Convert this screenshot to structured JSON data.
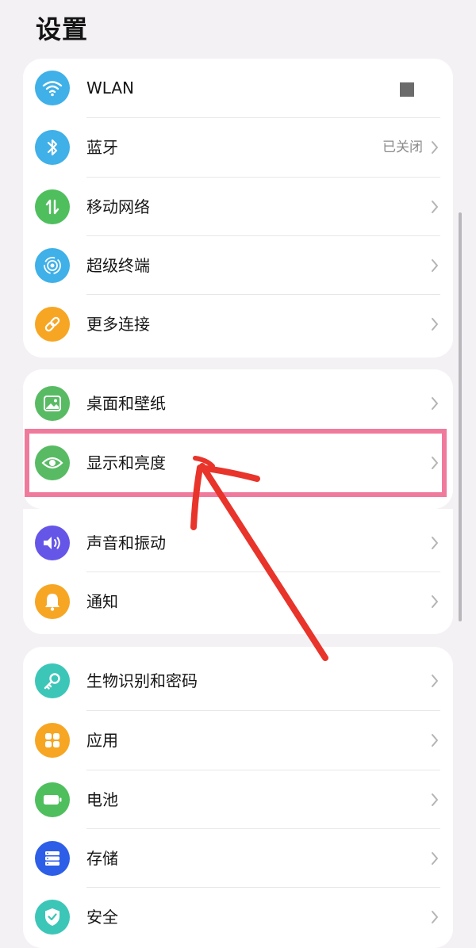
{
  "header": {
    "title": "设置"
  },
  "colors": {
    "wifi": "#3fb0e8",
    "bluetooth": "#3fb0e8",
    "mobile": "#4fbf5e",
    "superdevice": "#3fb0e8",
    "more": "#f7a623",
    "wallpaper": "#58bb64",
    "display": "#58bb64",
    "sound": "#6556e8",
    "notification": "#f7a623",
    "biometrics": "#3cc6b8",
    "apps": "#f7a623",
    "battery": "#4fbf5e",
    "storage": "#2d5ee8",
    "security": "#3cc6b8",
    "highlight": "#f07a9b",
    "arrow": "#e8342a"
  },
  "groups": [
    {
      "items": [
        {
          "label": "WLAN",
          "icon": "wifi-icon"
        },
        {
          "label": "蓝牙",
          "icon": "bluetooth-icon",
          "status": "已关闭"
        },
        {
          "label": "移动网络",
          "icon": "mobile-data-icon"
        },
        {
          "label": "超级终端",
          "icon": "super-device-icon"
        },
        {
          "label": "更多连接",
          "icon": "link-icon"
        }
      ]
    },
    {
      "items": [
        {
          "label": "桌面和壁纸",
          "icon": "wallpaper-icon"
        },
        {
          "label": "显示和亮度",
          "icon": "eye-icon"
        },
        {
          "label": "声音和振动",
          "icon": "speaker-icon"
        },
        {
          "label": "通知",
          "icon": "bell-icon"
        }
      ]
    },
    {
      "items": [
        {
          "label": "生物识别和密码",
          "icon": "key-icon"
        },
        {
          "label": "应用",
          "icon": "apps-grid-icon"
        },
        {
          "label": "电池",
          "icon": "battery-icon"
        },
        {
          "label": "存储",
          "icon": "storage-icon"
        },
        {
          "label": "安全",
          "icon": "shield-icon"
        }
      ]
    }
  ]
}
